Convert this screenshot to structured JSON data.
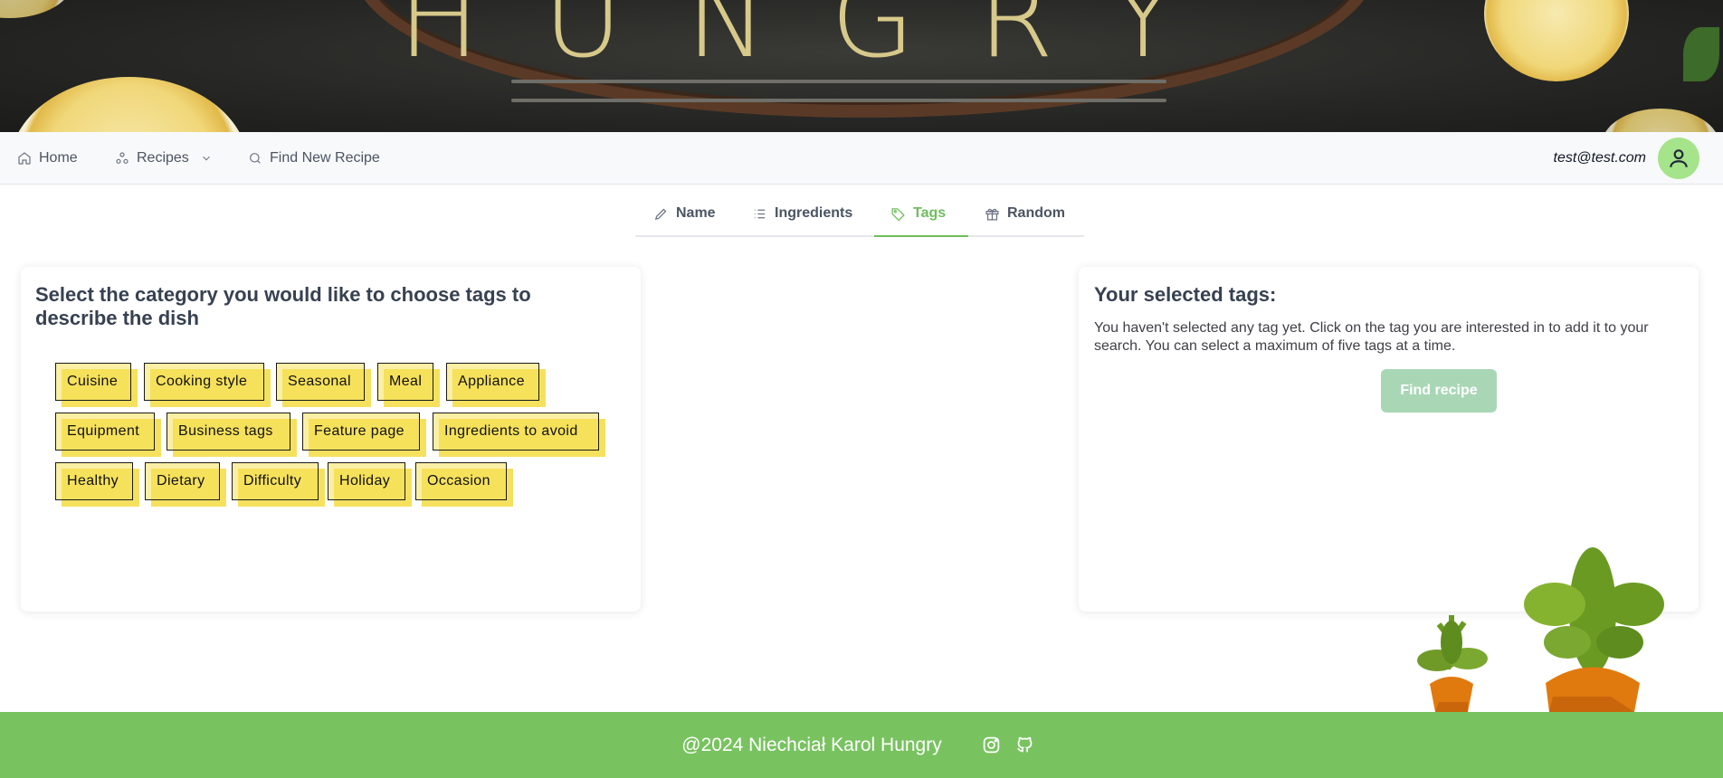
{
  "nav": {
    "home": "Home",
    "recipes": "Recipes",
    "find_new_recipe": "Find New Recipe",
    "user_email": "test@test.com"
  },
  "tabs": [
    {
      "label": "Name",
      "icon": "pencil-icon",
      "active": false
    },
    {
      "label": "Ingredients",
      "icon": "list-icon",
      "active": false
    },
    {
      "label": "Tags",
      "icon": "tag-icon",
      "active": true
    },
    {
      "label": "Random",
      "icon": "gift-icon",
      "active": false
    }
  ],
  "left_card": {
    "title": "Select the category you would like to choose tags to describe the dish",
    "tags": [
      "Cuisine",
      "Cooking style",
      "Seasonal",
      "Meal",
      "Appliance",
      "Equipment",
      "Business tags",
      "Feature page",
      "Ingredients to avoid",
      "Healthy",
      "Dietary",
      "Difficulty",
      "Holiday",
      "Occasion"
    ]
  },
  "right_card": {
    "title": "Your selected tags:",
    "description": "You haven't selected any tag yet. Click on the tag you are interested in to add it to your search. You can select a maximum of five tags at a time.",
    "button": "Find recipe"
  },
  "footer": {
    "text": "@2024 Niechciał Karol Hungry",
    "icons": [
      "instagram-icon",
      "github-icon"
    ]
  },
  "colors": {
    "accent": "#6ebd5c",
    "footer": "#78c35f",
    "tag_highlight": "#f5e15e",
    "avatar": "#a5e48a"
  }
}
